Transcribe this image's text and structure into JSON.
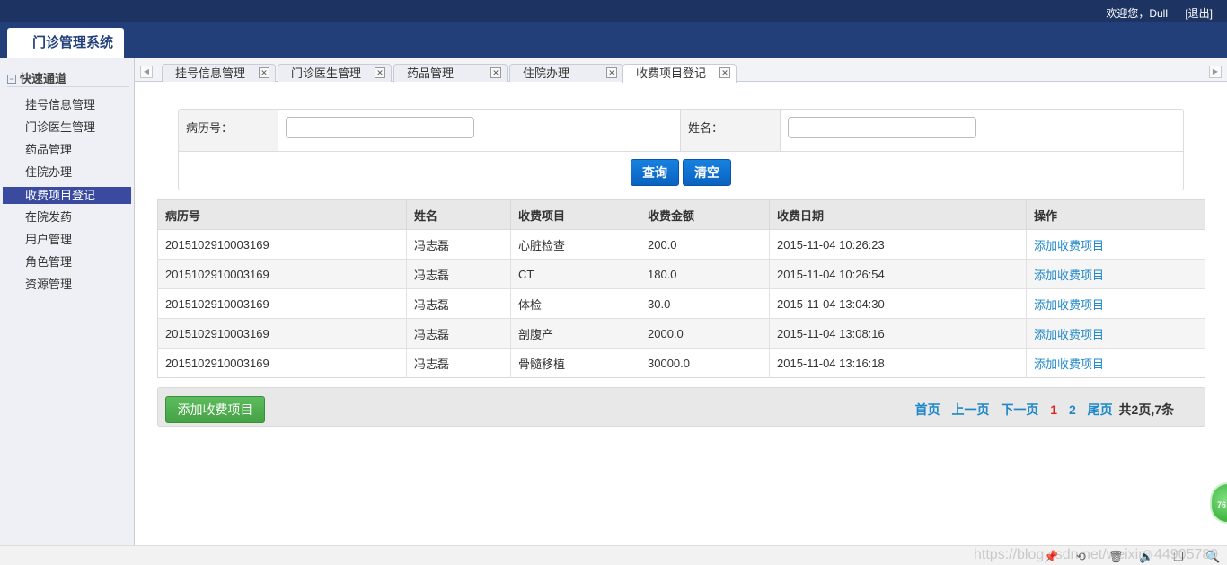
{
  "topbar": {
    "welcome": "欢迎您，Dull",
    "logout": "[退出]"
  },
  "header": {
    "system_title": "门诊管理系统"
  },
  "sidebar": {
    "section_title": "快速通道",
    "items": [
      {
        "label": "挂号信息管理"
      },
      {
        "label": "门诊医生管理"
      },
      {
        "label": "药品管理"
      },
      {
        "label": "住院办理"
      },
      {
        "label": "收费项目登记",
        "active": true
      },
      {
        "label": "在院发药"
      },
      {
        "label": "用户管理"
      },
      {
        "label": "角色管理"
      },
      {
        "label": "资源管理"
      }
    ]
  },
  "tabs": [
    {
      "label": "挂号信息管理"
    },
    {
      "label": "门诊医生管理"
    },
    {
      "label": "药品管理"
    },
    {
      "label": "住院办理"
    },
    {
      "label": "收费项目登记",
      "active": true
    }
  ],
  "search": {
    "record_label": "病历号：",
    "name_label": "姓名：",
    "record_value": "",
    "name_value": "",
    "query_button": "查询",
    "clear_button": "清空"
  },
  "table": {
    "headers": [
      "病历号",
      "姓名",
      "收费项目",
      "收费金额",
      "收费日期",
      "操作"
    ],
    "rows": [
      [
        "2015102910003169",
        "冯志磊",
        "心脏检查",
        "200.0",
        "2015-11-04 10:26:23",
        "添加收费项目"
      ],
      [
        "2015102910003169",
        "冯志磊",
        "CT",
        "180.0",
        "2015-11-04 10:26:54",
        "添加收费项目"
      ],
      [
        "2015102910003169",
        "冯志磊",
        "体检",
        "30.0",
        "2015-11-04 13:04:30",
        "添加收费项目"
      ],
      [
        "2015102910003169",
        "冯志磊",
        "剖腹产",
        "2000.0",
        "2015-11-04 13:08:16",
        "添加收费项目"
      ],
      [
        "2015102910003169",
        "冯志磊",
        "骨髓移植",
        "30000.0",
        "2015-11-04 13:16:18",
        "添加收费项目"
      ]
    ]
  },
  "footer": {
    "add_button": "添加收费项目",
    "pager": {
      "first": "首页",
      "prev": "上一页",
      "next": "下一页",
      "page1": "1",
      "page2": "2",
      "last": "尾页",
      "summary": "共2页,7条"
    }
  },
  "float_badge": "76",
  "watermark": "https://blog.csdn.net/weixin_44905789"
}
